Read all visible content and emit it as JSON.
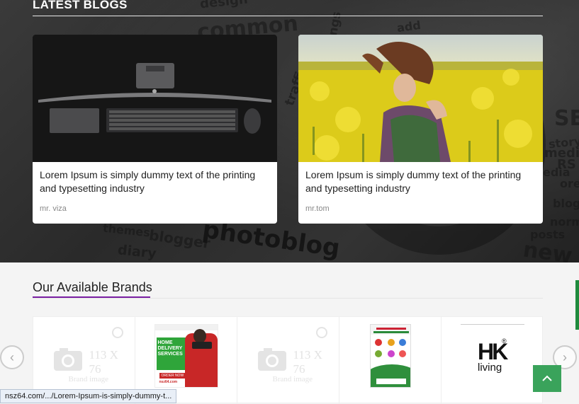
{
  "blogs": {
    "title": "LATEST BLOGS",
    "posts": [
      {
        "caption": "Lorem Ipsum is simply dummy text of the printing and typesetting industry",
        "author": "mr. viza"
      },
      {
        "caption": "Lorem Ipsum is simply dummy text of the printing and typesetting industry",
        "author": "mr.tom"
      }
    ]
  },
  "background_words": [
    "design",
    "common",
    "settings",
    "add",
    "traffic",
    "photoblog",
    "blogger",
    "diary",
    "themes",
    "new",
    "posts",
    "media",
    "SE",
    "RS",
    "story",
    "blog",
    "normal",
    "edia",
    "ore"
  ],
  "brands": {
    "title": "Our Available Brands",
    "items": [
      {
        "type": "placeholder",
        "size_label": "113 X 76",
        "caption": "Brand image"
      },
      {
        "type": "poster",
        "headline": "HOME DELIVERY SERVICES",
        "sub": "ORDER NOW",
        "site": "nsz64.com"
      },
      {
        "type": "placeholder",
        "size_label": "113 X 76",
        "caption": "Brand image"
      },
      {
        "type": "flyer"
      },
      {
        "type": "logo",
        "logo_text": "HK",
        "logo_sub": "living",
        "logo_mark": "®"
      }
    ]
  },
  "nav": {
    "prev_icon": "chevron-left-icon",
    "next_icon": "chevron-right-icon"
  },
  "scroll_top": {
    "icon": "chevron-up-icon"
  },
  "status_bar": {
    "url": "nsz64.com/.../Lorem-Ipsum-is-simply-dummy-t..."
  },
  "colors": {
    "accent": "#7a1fa2",
    "green": "#3aa35b",
    "side_tab": "#1f8a3d",
    "flowers": "#e2d21a"
  }
}
